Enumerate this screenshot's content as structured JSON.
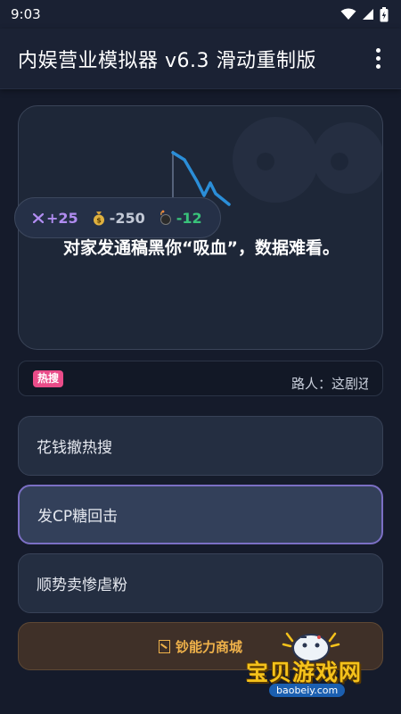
{
  "status_bar": {
    "time": "9:03"
  },
  "app_bar": {
    "title": "内娱营业模拟器 v6.3 滑动重制版",
    "menu_icon": "more-vert-icon"
  },
  "event": {
    "text": "对家发通稿黑你“吸血”，数据难看。",
    "effects": [
      {
        "icon": "fans-icon",
        "value": "+25",
        "color": "#b08cf0"
      },
      {
        "icon": "money-bag-icon",
        "value": "-250",
        "color": "#c3c9d6"
      },
      {
        "icon": "bomb-icon",
        "value": "-12",
        "color": "#39c27a"
      }
    ]
  },
  "news": {
    "tag": "热搜",
    "ticker": "路人：这剧还"
  },
  "choices": [
    "花钱撤热搜",
    "发CP糖回击",
    "顺势卖惨虐粉"
  ],
  "shop": {
    "label": "钞能力商城"
  },
  "watermark": {
    "name": "宝贝游戏网",
    "url": "baobeiy.com"
  },
  "colors": {
    "background": "#151b2b",
    "card": "#1e2738",
    "accent": "#7b6fc4",
    "hot": "#ea4c89",
    "gold": "#f0b24a",
    "chart_line": "#2b8ed8"
  }
}
